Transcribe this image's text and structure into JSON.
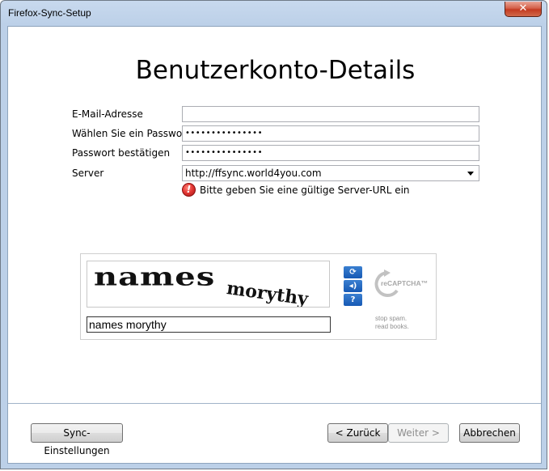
{
  "window": {
    "title": "Firefox-Sync-Setup",
    "close_glyph": "✕"
  },
  "page": {
    "heading": "Benutzerkonto-Details"
  },
  "form": {
    "email_label": "E-Mail-Adresse",
    "email_value": "",
    "password_label": "Wählen Sie ein Passwort",
    "password_value": "•••••••••••••••",
    "confirm_label": "Passwort bestätigen",
    "confirm_value": "•••••••••••••••",
    "server_label": "Server",
    "server_value": "http://ffsync.world4you.com",
    "server_error": "Bitte geben Sie eine gültige Server-URL ein"
  },
  "captcha": {
    "word1": "names",
    "word2": "morythy",
    "response_value": "names morythy",
    "refresh_icon": "refresh-icon",
    "audio_icon": "audio-icon",
    "help_icon": "help-icon",
    "logo_text": "reCAPTCHA™",
    "tagline_line1": "stop spam.",
    "tagline_line2": "read books."
  },
  "buttons": {
    "sync_settings": "Sync-Einstellungen",
    "back": "< Zurück",
    "next": "Weiter >",
    "cancel": "Abbrechen"
  },
  "colors": {
    "error_red": "#e53935",
    "captcha_blue": "#1659b4",
    "window_frame": "#bcd0e8"
  }
}
